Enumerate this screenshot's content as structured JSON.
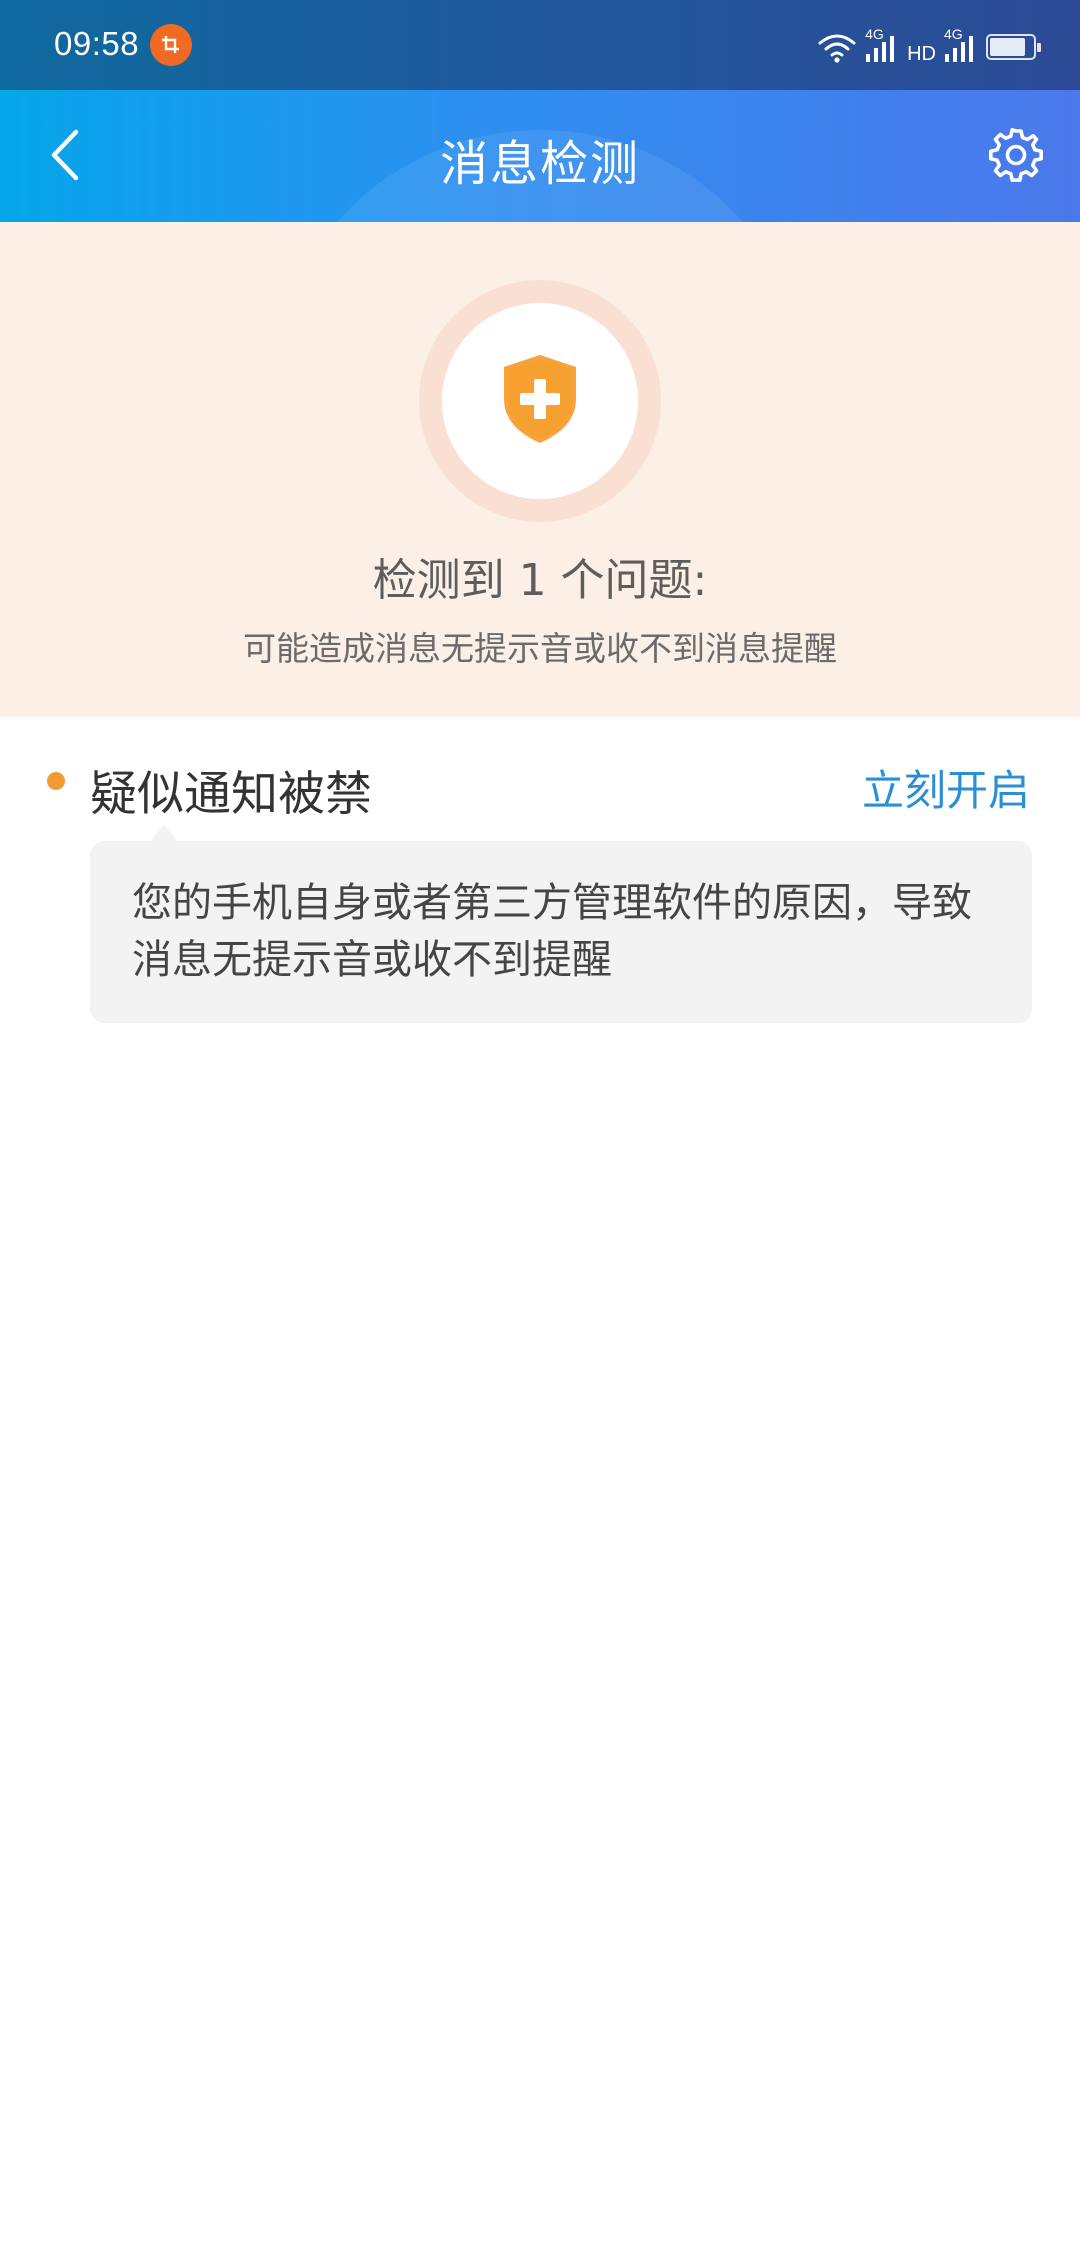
{
  "status_bar": {
    "time": "09:58",
    "network_label_1": "4G",
    "hd_label": "HD",
    "network_label_2": "4G",
    "battery_level": 0.85,
    "icons": [
      "screenshot-notification-icon",
      "wifi-icon",
      "signal-icon",
      "signal-icon",
      "battery-icon"
    ]
  },
  "header": {
    "title": "消息检测",
    "back_icon": "chevron-left-icon",
    "settings_icon": "gear-icon"
  },
  "result": {
    "icon": "shield-plus-icon",
    "title": "检测到 1 个问题:",
    "subtitle": "可能造成消息无提示音或收不到消息提醒"
  },
  "issues": [
    {
      "title": "疑似通知被禁",
      "action_label": "立刻开启",
      "description": "您的手机自身或者第三方管理软件的原因，导致消息无提示音或收不到提醒"
    }
  ],
  "colors": {
    "header_gradient_start": "#05a6ea",
    "header_gradient_end": "#4b78ea",
    "result_background": "#fcefe6",
    "shield": "#f7a23a",
    "issue_dot": "#f39a35",
    "action_link": "#2b8fd8",
    "notification_badge": "#f06a24"
  }
}
